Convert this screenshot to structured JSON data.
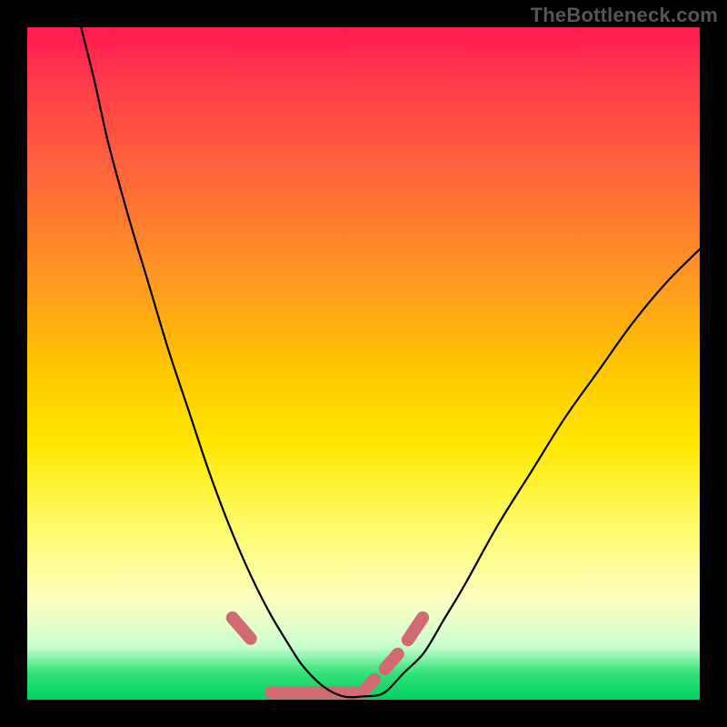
{
  "watermark": "TheBottleneck.com",
  "chart_data": {
    "type": "line",
    "title": "",
    "xlabel": "",
    "ylabel": "",
    "xlim": [
      0,
      100
    ],
    "ylim": [
      0,
      100
    ],
    "grid": false,
    "legend": false,
    "note": "Axes and ticks are not drawn in the source image; values are estimated from pixel positions relative to the 740x740 plot area, with x and y scaled 0-100 (y=0 at top, y=100 at bottom).",
    "series": [
      {
        "name": "bottleneck-curve",
        "x": [
          8,
          10,
          12,
          15,
          18,
          21,
          24,
          27,
          30,
          33,
          36,
          39,
          41,
          44,
          47,
          50,
          53,
          56,
          59,
          62,
          65,
          70,
          75,
          80,
          85,
          90,
          95,
          100
        ],
        "y": [
          0,
          8,
          17,
          28,
          38,
          48,
          57,
          66,
          74,
          81,
          87,
          92,
          95,
          98,
          99.5,
          99.5,
          99,
          96,
          93,
          88,
          83,
          74,
          66,
          58,
          51,
          44,
          38,
          33
        ]
      }
    ],
    "highlight_segments": [
      {
        "name": "valley-left",
        "points": [
          [
            30.5,
            87.8
          ],
          [
            33.2,
            90.9
          ]
        ]
      },
      {
        "name": "valley-floor",
        "points": [
          [
            36.2,
            98.9
          ],
          [
            50.0,
            98.9
          ]
        ]
      },
      {
        "name": "valley-right-1",
        "points": [
          [
            50.6,
            98.1
          ],
          [
            51.6,
            97.0
          ]
        ]
      },
      {
        "name": "valley-right-2",
        "points": [
          [
            53.2,
            95.4
          ],
          [
            55.1,
            93.2
          ]
        ]
      },
      {
        "name": "valley-right-3",
        "points": [
          [
            56.6,
            91.1
          ],
          [
            58.8,
            87.8
          ]
        ]
      }
    ],
    "background": {
      "type": "vertical-gradient",
      "stops": [
        {
          "pos": 0.0,
          "color": "#ff1a53"
        },
        {
          "pos": 0.5,
          "color": "#ffc400"
        },
        {
          "pos": 0.85,
          "color": "#ffffc0"
        },
        {
          "pos": 1.0,
          "color": "#00d060"
        }
      ]
    }
  }
}
